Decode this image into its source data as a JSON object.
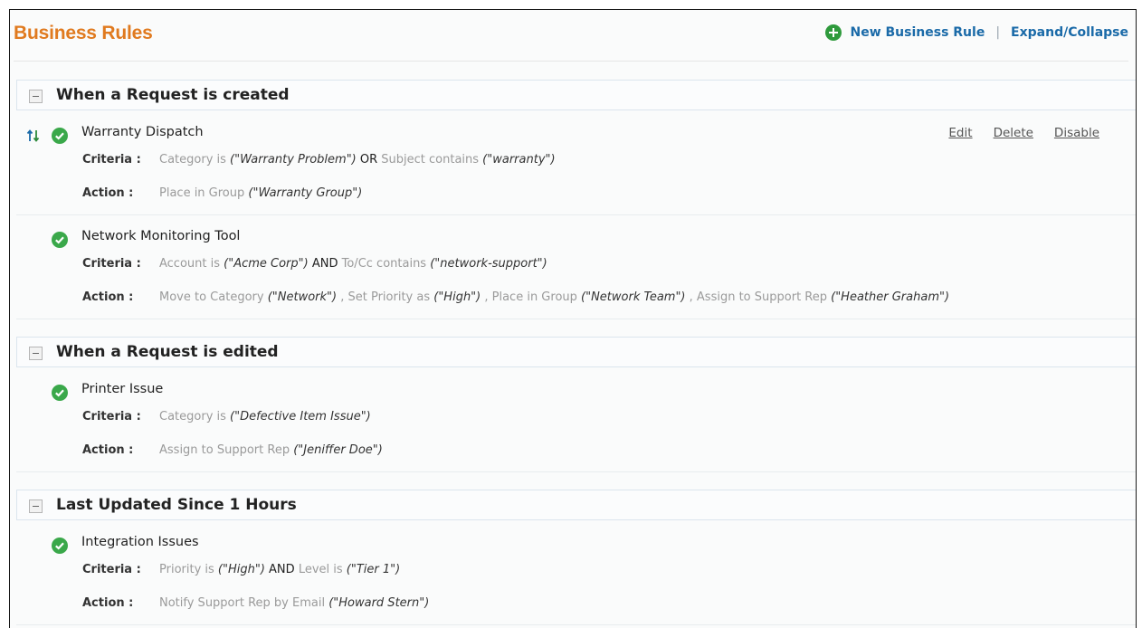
{
  "header": {
    "title": "Business Rules",
    "new_rule_label": "New Business Rule",
    "separator": "|",
    "expand_collapse_label": "Expand/Collapse"
  },
  "labels": {
    "criteria": "Criteria :",
    "action": "Action :"
  },
  "rule_actions": {
    "edit": "Edit",
    "delete": "Delete",
    "disable": "Disable"
  },
  "icons": {
    "add": "plus-circle-icon",
    "status": "check-circle-icon",
    "reorder": "reorder-arrows-icon",
    "collapse": "minus-box-icon"
  },
  "colors": {
    "title": "#e07a1f",
    "link": "#1a6aa8",
    "check": "#3aa84a"
  },
  "sections": [
    {
      "title": "When a Request is created",
      "rules": [
        {
          "name": "Warranty Dispatch",
          "criteria": [
            {
              "t": "Category is ",
              "c": "g"
            },
            {
              "t": "(\"Warranty Problem\")",
              "c": "v"
            },
            {
              "t": " OR ",
              "c": "k"
            },
            {
              "t": "Subject contains ",
              "c": "g"
            },
            {
              "t": "(\"warranty\")",
              "c": "v"
            }
          ],
          "action": [
            {
              "t": "Place in Group ",
              "c": "g"
            },
            {
              "t": "(\"Warranty Group\")",
              "c": "v"
            }
          ]
        },
        {
          "name": "Network Monitoring Tool",
          "criteria": [
            {
              "t": "Account is ",
              "c": "g"
            },
            {
              "t": "(\"Acme Corp\")",
              "c": "v"
            },
            {
              "t": " AND ",
              "c": "k"
            },
            {
              "t": "To/Cc contains ",
              "c": "g"
            },
            {
              "t": "(\"network-support\")",
              "c": "v"
            }
          ],
          "action": [
            {
              "t": "Move to Category ",
              "c": "g"
            },
            {
              "t": "(\"Network\")",
              "c": "v"
            },
            {
              "t": " , Set Priority as ",
              "c": "g"
            },
            {
              "t": "(\"High\")",
              "c": "v"
            },
            {
              "t": " , Place in Group ",
              "c": "g"
            },
            {
              "t": "(\"Network Team\")",
              "c": "v"
            },
            {
              "t": " , Assign to Support Rep ",
              "c": "g"
            },
            {
              "t": "(\"Heather Graham\")",
              "c": "v"
            }
          ]
        }
      ]
    },
    {
      "title": "When a Request is edited",
      "rules": [
        {
          "name": "Printer Issue",
          "criteria": [
            {
              "t": "Category is ",
              "c": "g"
            },
            {
              "t": "(\"Defective Item Issue\")",
              "c": "v"
            }
          ],
          "action": [
            {
              "t": "Assign to Support Rep ",
              "c": "g"
            },
            {
              "t": "(\"Jeniffer Doe\")",
              "c": "v"
            }
          ]
        }
      ]
    },
    {
      "title": "Last Updated Since 1 Hours",
      "rules": [
        {
          "name": "Integration Issues",
          "criteria": [
            {
              "t": "Priority is ",
              "c": "g"
            },
            {
              "t": "(\"High\")",
              "c": "v"
            },
            {
              "t": " AND ",
              "c": "k"
            },
            {
              "t": "Level is ",
              "c": "g"
            },
            {
              "t": "(\"Tier 1\")",
              "c": "v"
            }
          ],
          "action": [
            {
              "t": "Notify Support Rep by Email ",
              "c": "g"
            },
            {
              "t": "(\"Howard Stern\")",
              "c": "v"
            }
          ]
        }
      ]
    }
  ]
}
